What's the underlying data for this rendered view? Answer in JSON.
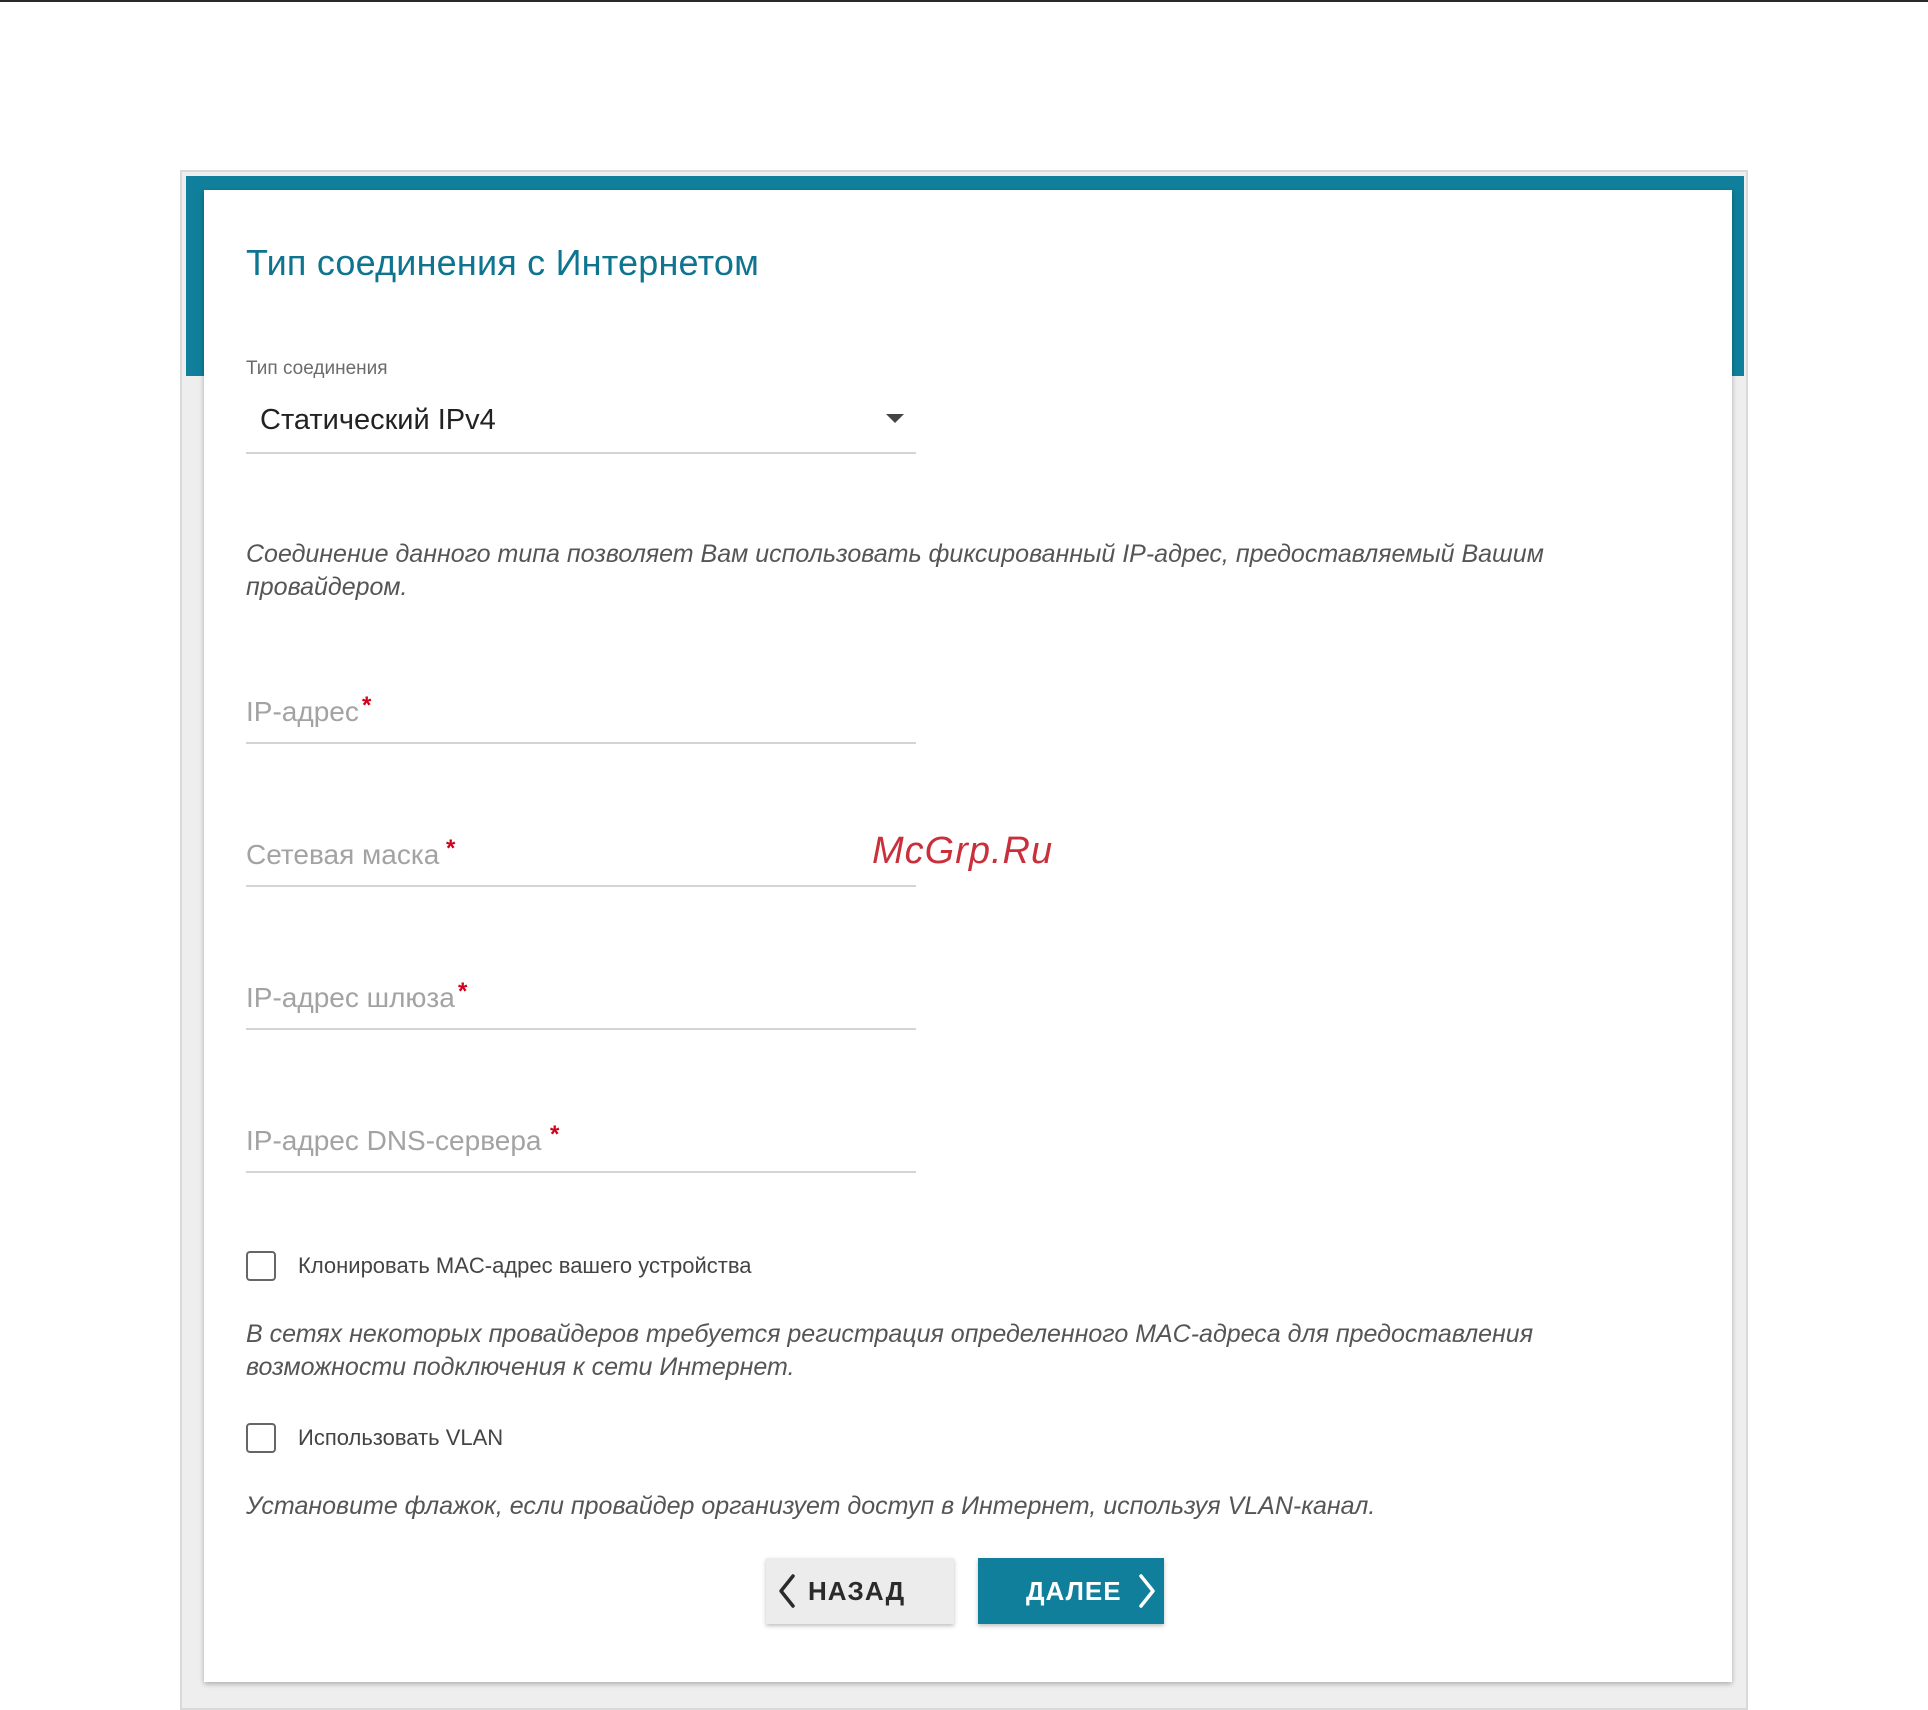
{
  "page": {
    "title": "Тип соединения с Интернетом"
  },
  "connection_type": {
    "label": "Тип соединения",
    "value": "Статический IPv4"
  },
  "description": "Соединение данного типа позволяет Вам использовать фиксированный IP-адрес, предоставляемый Вашим провайдером.",
  "fields": {
    "ip_address": {
      "placeholder": "IP-адрес",
      "value": "",
      "required_mark": "*"
    },
    "netmask": {
      "placeholder": "Сетевая маска",
      "value": "",
      "required_mark": "*"
    },
    "gateway": {
      "placeholder": "IP-адрес шлюза",
      "value": "",
      "required_mark": "*"
    },
    "dns": {
      "placeholder": "IP-адрес DNS-сервера",
      "value": "",
      "required_mark": "*"
    }
  },
  "clone_mac": {
    "label": "Клонировать MAC-адрес вашего устройства",
    "checked": false,
    "hint": "В сетях некоторых провайдеров требуется регистрация определенного MAC-адреса для предоставления возможности подключения к сети Интернет."
  },
  "vlan": {
    "label": "Использовать VLAN",
    "checked": false,
    "hint": "Установите флажок, если провайдер организует доступ в Интернет, используя VLAN-канал."
  },
  "buttons": {
    "back_label": "НАЗАД",
    "next_label": "ДАЛЕЕ"
  },
  "watermark": "McGrp.Ru",
  "colors": {
    "accent": "#0f7f9b",
    "title": "#0e7490",
    "required": "#d0021b",
    "watermark": "#c9303c"
  },
  "icons": {
    "dropdown": "caret-down-icon",
    "back": "chevron-left-icon",
    "next": "chevron-right-icon"
  }
}
